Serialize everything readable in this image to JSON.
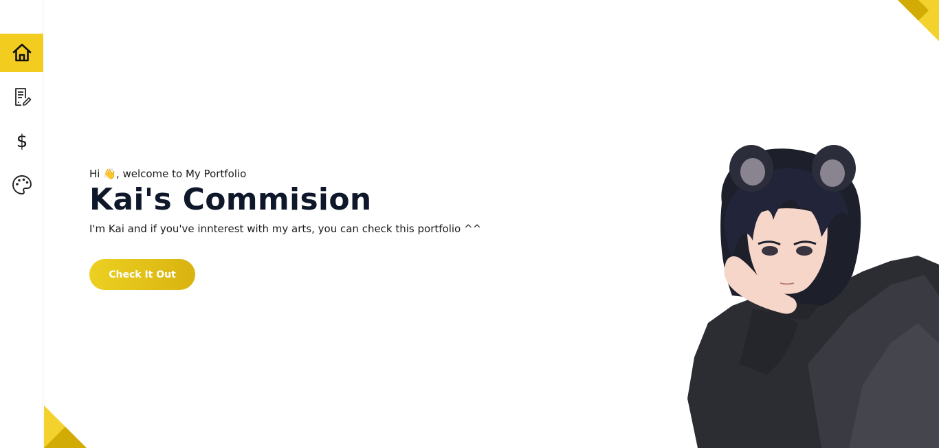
{
  "sidebar": {
    "items": [
      {
        "icon": "home-icon",
        "active": true
      },
      {
        "icon": "document-edit-icon",
        "active": false
      },
      {
        "icon": "dollar-icon",
        "active": false
      },
      {
        "icon": "palette-icon",
        "active": false
      }
    ]
  },
  "hero": {
    "greeting_prefix": "Hi ",
    "greeting_emoji": "👋",
    "greeting_suffix": ", welcome to My Portfolio",
    "title": "Kai's Commision",
    "subtitle": "I'm Kai and if you've innterest with my arts, you can check this portfolio ^^",
    "cta_label": "Check It Out"
  },
  "colors": {
    "accent": "#f2cc1f",
    "accent_dark": "#d4ae0b",
    "title": "#0f172a",
    "text": "#1a1a1a"
  }
}
